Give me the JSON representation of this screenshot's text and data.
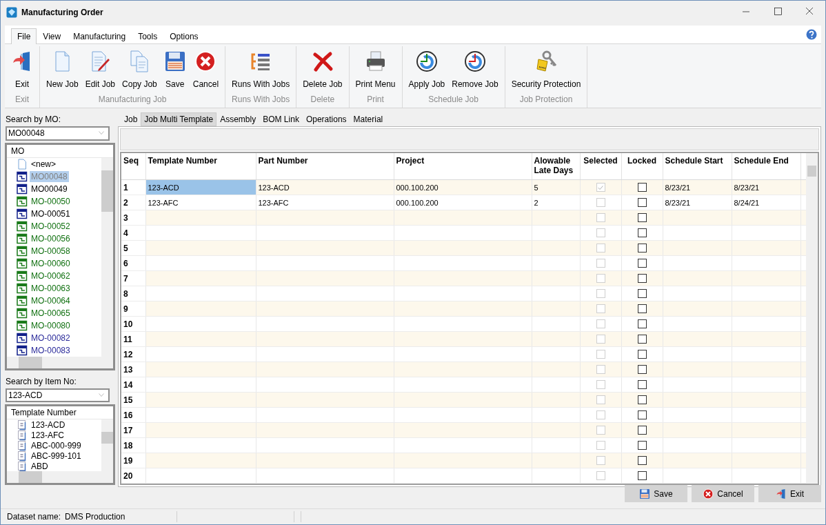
{
  "window": {
    "title": "Manufacturing Order"
  },
  "menu": [
    {
      "label": "File",
      "selected": true
    },
    {
      "label": "View",
      "selected": false
    },
    {
      "label": "Manufacturing",
      "selected": false
    },
    {
      "label": "Tools",
      "selected": false
    },
    {
      "label": "Options",
      "selected": false
    }
  ],
  "ribbon": [
    {
      "group": "Exit",
      "buttons": [
        {
          "label": "Exit",
          "kind": "exit"
        }
      ]
    },
    {
      "group": "Manufacturing Job",
      "buttons": [
        {
          "label": "New Job",
          "kind": "new"
        },
        {
          "label": "Edit Job",
          "kind": "edit"
        },
        {
          "label": "Copy Job",
          "kind": "copy"
        },
        {
          "label": "Save",
          "kind": "save"
        },
        {
          "label": "Cancel",
          "kind": "cancel"
        }
      ]
    },
    {
      "group": "Runs With Jobs",
      "buttons": [
        {
          "label": "Runs With Jobs",
          "kind": "runs"
        }
      ]
    },
    {
      "group": "Delete",
      "buttons": [
        {
          "label": "Delete Job",
          "kind": "delete"
        }
      ]
    },
    {
      "group": "Print",
      "buttons": [
        {
          "label": "Print Menu",
          "kind": "print"
        }
      ]
    },
    {
      "group": "Schedule Job",
      "buttons": [
        {
          "label": "Apply Job",
          "kind": "apply"
        },
        {
          "label": "Remove Job",
          "kind": "remove"
        }
      ]
    },
    {
      "group": "Job Protection",
      "buttons": [
        {
          "label": "Security Protection",
          "kind": "security"
        }
      ]
    }
  ],
  "mo_search": {
    "label": "Search by MO:",
    "value": "MO00048"
  },
  "mo_tree": {
    "header": "MO",
    "items": [
      {
        "label": "<new>",
        "kind": "new",
        "selected": false,
        "color": "#000000"
      },
      {
        "label": "MO00048",
        "kind": "order",
        "selected": true,
        "color": "#808080"
      },
      {
        "label": "MO00049",
        "kind": "order",
        "selected": false,
        "color": "#000000"
      },
      {
        "label": "MO-00050",
        "kind": "order",
        "selected": false,
        "color": "#107010"
      },
      {
        "label": "MO-00051",
        "kind": "order",
        "selected": false,
        "color": "#000000"
      },
      {
        "label": "MO-00052",
        "kind": "order",
        "selected": false,
        "color": "#107010"
      },
      {
        "label": "MO-00056",
        "kind": "order",
        "selected": false,
        "color": "#107010"
      },
      {
        "label": "MO-00058",
        "kind": "order",
        "selected": false,
        "color": "#107010"
      },
      {
        "label": "MO-00060",
        "kind": "order",
        "selected": false,
        "color": "#107010"
      },
      {
        "label": "MO-00062",
        "kind": "order",
        "selected": false,
        "color": "#107010"
      },
      {
        "label": "MO-00063",
        "kind": "order",
        "selected": false,
        "color": "#107010"
      },
      {
        "label": "MO-00064",
        "kind": "order",
        "selected": false,
        "color": "#107010"
      },
      {
        "label": "MO-00065",
        "kind": "order",
        "selected": false,
        "color": "#107010"
      },
      {
        "label": "MO-00080",
        "kind": "order",
        "selected": false,
        "color": "#107010"
      },
      {
        "label": "MO-00082",
        "kind": "order",
        "selected": false,
        "color": "#2a2a9a"
      },
      {
        "label": "MO-00083",
        "kind": "order",
        "selected": false,
        "color": "#2a2a9a"
      }
    ]
  },
  "item_search": {
    "label": "Search by Item No:",
    "value": "123-ACD"
  },
  "template_tree": {
    "header": "Template Number",
    "items": [
      {
        "label": "123-ACD"
      },
      {
        "label": "123-AFC"
      },
      {
        "label": "ABC-000-999"
      },
      {
        "label": "ABC-999-101"
      },
      {
        "label": "ABD"
      }
    ]
  },
  "tabs": [
    {
      "label": "Job",
      "selected": false
    },
    {
      "label": "Job Multi Template",
      "selected": true
    },
    {
      "label": "Assembly",
      "selected": false
    },
    {
      "label": "BOM Link",
      "selected": false
    },
    {
      "label": "Operations",
      "selected": false
    },
    {
      "label": "Material",
      "selected": false
    }
  ],
  "grid": {
    "columns": [
      {
        "label": "Seq",
        "kind": "seq"
      },
      {
        "label": "Template Number",
        "kind": "text"
      },
      {
        "label": "Part Number",
        "kind": "text"
      },
      {
        "label": "Project",
        "kind": "text"
      },
      {
        "label": "Alowable Late Days",
        "kind": "text"
      },
      {
        "label": "Selected",
        "kind": "check",
        "disabled": true
      },
      {
        "label": "Locked",
        "kind": "check",
        "disabled": false
      },
      {
        "label": "Schedule Start",
        "kind": "text"
      },
      {
        "label": "Schedule End",
        "kind": "text"
      }
    ],
    "rows": [
      {
        "seq": "1",
        "template_number": "123-ACD",
        "part_number": "123-ACD",
        "project": "000.100.200",
        "late_days": "5",
        "selected_checked": true,
        "locked": false,
        "schedule_start": "8/23/21",
        "schedule_end": "8/23/21",
        "focused": true
      },
      {
        "seq": "2",
        "template_number": "123-AFC",
        "part_number": "123-AFC",
        "project": "000.100.200",
        "late_days": "2",
        "selected_checked": false,
        "locked": false,
        "schedule_start": "8/23/21",
        "schedule_end": "8/24/21",
        "focused": false
      },
      {
        "seq": "3",
        "selected_checked": false,
        "locked": false,
        "focused": false
      },
      {
        "seq": "4",
        "selected_checked": false,
        "locked": false,
        "focused": false
      },
      {
        "seq": "5",
        "selected_checked": false,
        "locked": false,
        "focused": false
      },
      {
        "seq": "6",
        "selected_checked": false,
        "locked": false,
        "focused": false
      },
      {
        "seq": "7",
        "selected_checked": false,
        "locked": false,
        "focused": false
      },
      {
        "seq": "8",
        "selected_checked": false,
        "locked": false,
        "focused": false
      },
      {
        "seq": "9",
        "selected_checked": false,
        "locked": false,
        "focused": false
      },
      {
        "seq": "10",
        "selected_checked": false,
        "locked": false,
        "focused": false
      },
      {
        "seq": "11",
        "selected_checked": false,
        "locked": false,
        "focused": false
      },
      {
        "seq": "12",
        "selected_checked": false,
        "locked": false,
        "focused": false
      },
      {
        "seq": "13",
        "selected_checked": false,
        "locked": false,
        "focused": false
      },
      {
        "seq": "14",
        "selected_checked": false,
        "locked": false,
        "focused": false
      },
      {
        "seq": "15",
        "selected_checked": false,
        "locked": false,
        "focused": false
      },
      {
        "seq": "16",
        "selected_checked": false,
        "locked": false,
        "focused": false
      },
      {
        "seq": "17",
        "selected_checked": false,
        "locked": false,
        "focused": false
      },
      {
        "seq": "18",
        "selected_checked": false,
        "locked": false,
        "focused": false
      },
      {
        "seq": "19",
        "selected_checked": false,
        "locked": false,
        "focused": false
      },
      {
        "seq": "20",
        "selected_checked": false,
        "locked": false,
        "focused": false
      }
    ]
  },
  "footer_buttons": [
    {
      "label": "Save",
      "kind": "save"
    },
    {
      "label": "Cancel",
      "kind": "cancel"
    },
    {
      "label": "Exit",
      "kind": "exit"
    }
  ],
  "status_bar": {
    "label": "Dataset name:",
    "value": "DMS Production"
  }
}
